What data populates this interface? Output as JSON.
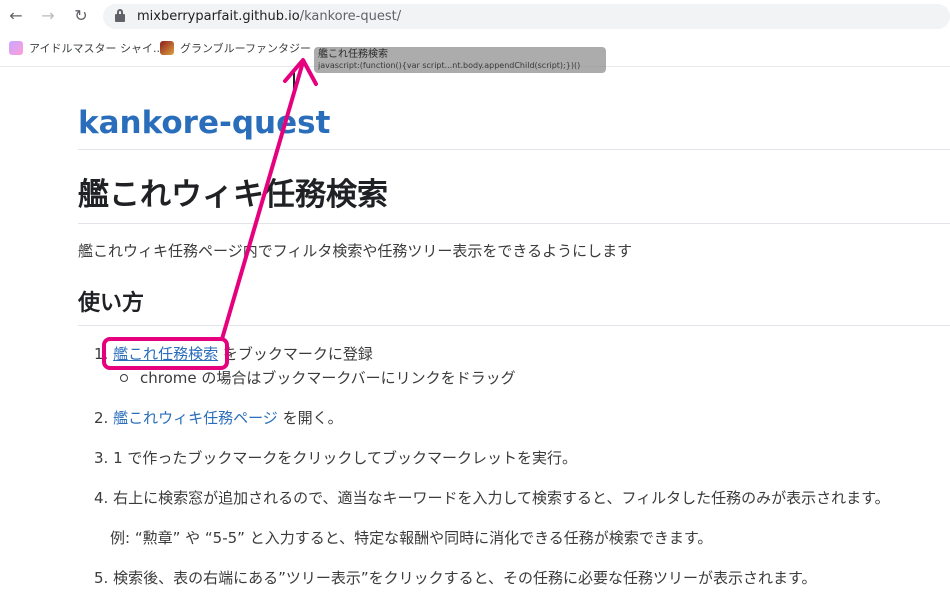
{
  "browser": {
    "url_host": "mixberryparfait.github.io",
    "url_path": "/kankore-quest/",
    "bookmarks": [
      {
        "label": "アイドルマスター シャイ..."
      },
      {
        "label": "グランブルーファンタジー"
      }
    ],
    "drag_ghost": {
      "title": "艦これ任務検索",
      "url": "javascript:(function(){var script...nt.body.appendChild(script);})()"
    }
  },
  "page": {
    "site_title": "kankore-quest",
    "heading": "艦これウィキ任務検索",
    "lead": "艦これウィキ任務ページ内でフィルタ検索や任務ツリー表示をできるようにします",
    "usage_heading": "使い方",
    "steps": [
      {
        "num": "1.",
        "link": "艦これ任務検索",
        "text": " をブックマークに登録",
        "sub": "chrome の場合はブックマークバーにリンクをドラッグ"
      },
      {
        "num": "2.",
        "link": "艦これウィキ任務ページ",
        "text": " を開く。"
      },
      {
        "num": "3.",
        "text": "1 で作ったブックマークをクリックしてブックマークレットを実行。"
      },
      {
        "num": "4.",
        "text": "右上に検索窓が追加されるので、適当なキーワードを入力して検索すると、フィルタした任務のみが表示されます。",
        "note": "例: “勲章” や “5-5” と入力すると、特定な報酬や同時に消化できる任務が検索できます。"
      },
      {
        "num": "5.",
        "text": "検索後、表の右端にある”ツリー表示”をクリックすると、その任務に必要な任務ツリーが表示されます。"
      }
    ]
  },
  "colors": {
    "link": "#2a6ebb",
    "annotation": "#e6007e"
  },
  "icons": [
    "back-arrow-icon",
    "forward-arrow-icon",
    "reload-icon",
    "lock-icon"
  ]
}
